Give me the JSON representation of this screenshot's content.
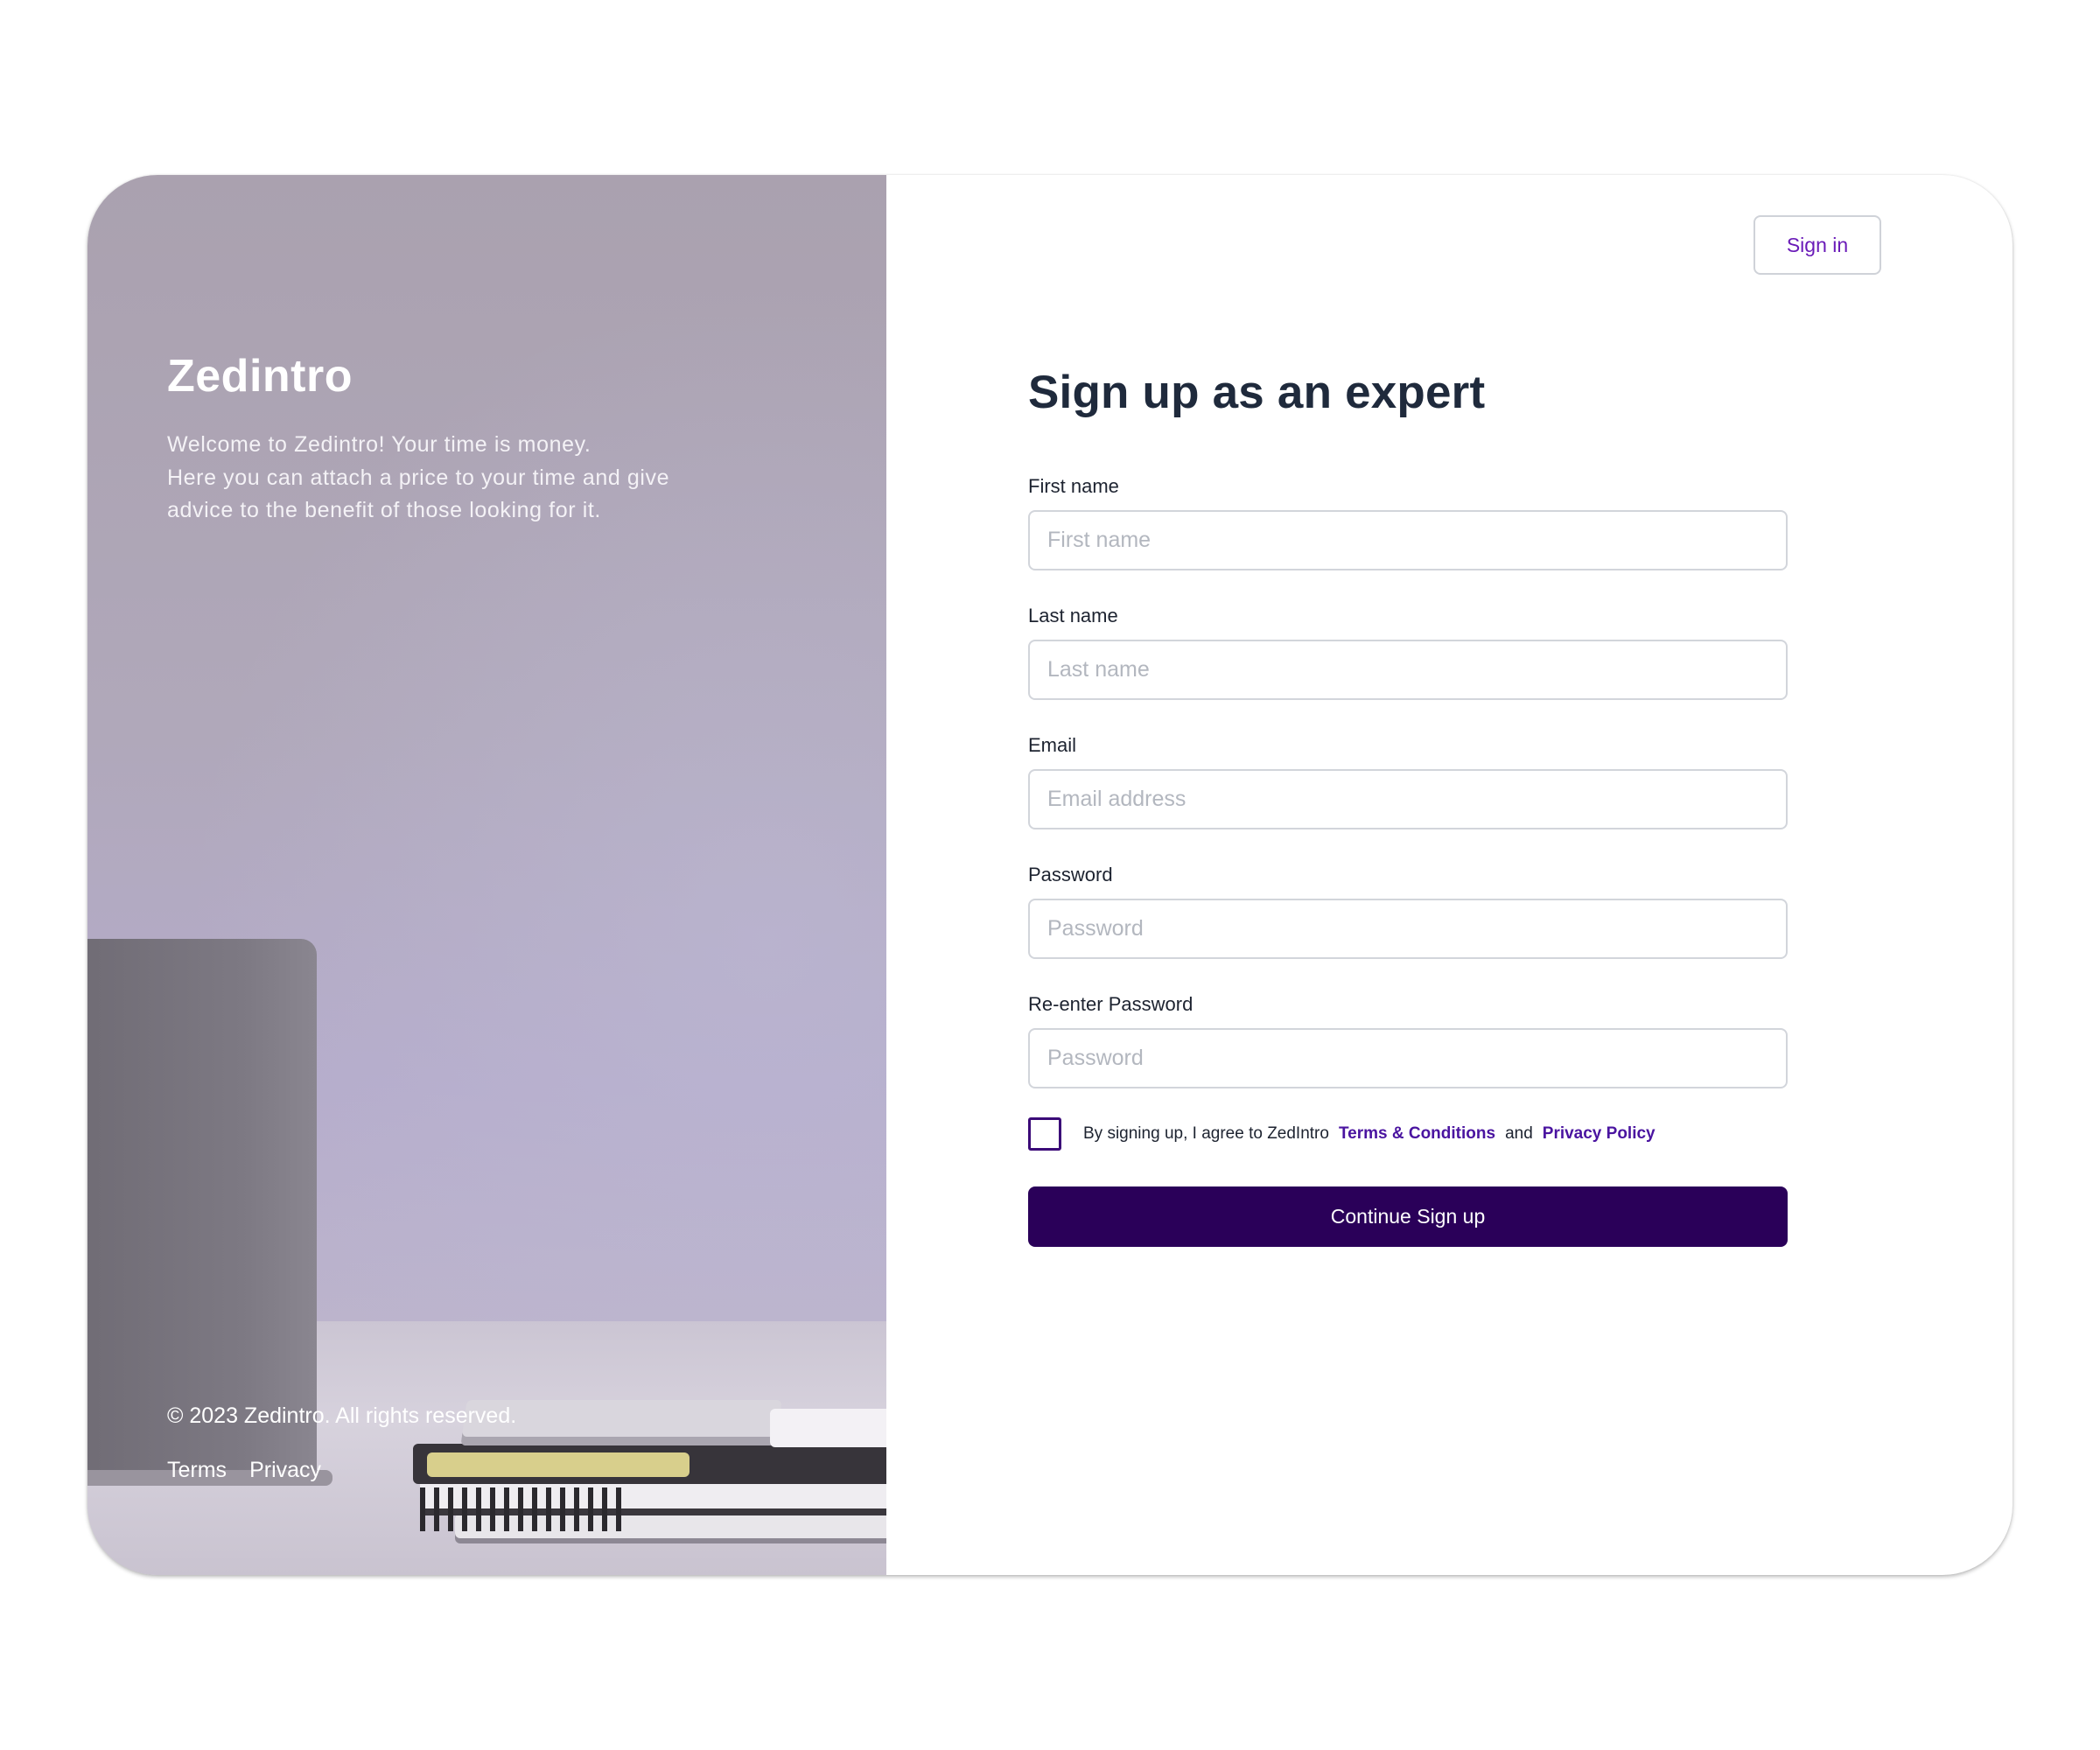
{
  "hero": {
    "brand": "Zedintro",
    "welcome_lines": [
      "Welcome to Zedintro! Your time is money.",
      "Here you can attach a price to your time and give",
      "advice to the benefit of those looking for it."
    ],
    "copyright": "© 2023 Zedintro. All rights reserved.",
    "links": [
      "Terms",
      "Privacy"
    ]
  },
  "header": {
    "signin_label": "Sign in"
  },
  "form": {
    "title": "Sign up as an expert",
    "fields": [
      {
        "label": "First name",
        "placeholder": "First name",
        "value": ""
      },
      {
        "label": "Last name",
        "placeholder": "Last name",
        "value": ""
      },
      {
        "label": "Email",
        "placeholder": "Email address",
        "value": ""
      },
      {
        "label": "Password",
        "placeholder": "Password",
        "value": ""
      },
      {
        "label": "Re-enter Password",
        "placeholder": "Password",
        "value": ""
      }
    ],
    "terms": {
      "checked": false,
      "prefix": "By signing up, I agree to ZedIntro",
      "terms_link": "Terms & Conditions",
      "conjunction": "and",
      "privacy_link": "Privacy Policy"
    },
    "submit_label": "Continue Sign up"
  },
  "colors": {
    "brand_dark": "#2a0059",
    "link_purple": "#4a14a0",
    "signin_text": "#6a1bb8",
    "title_text": "#1f2a3c"
  }
}
